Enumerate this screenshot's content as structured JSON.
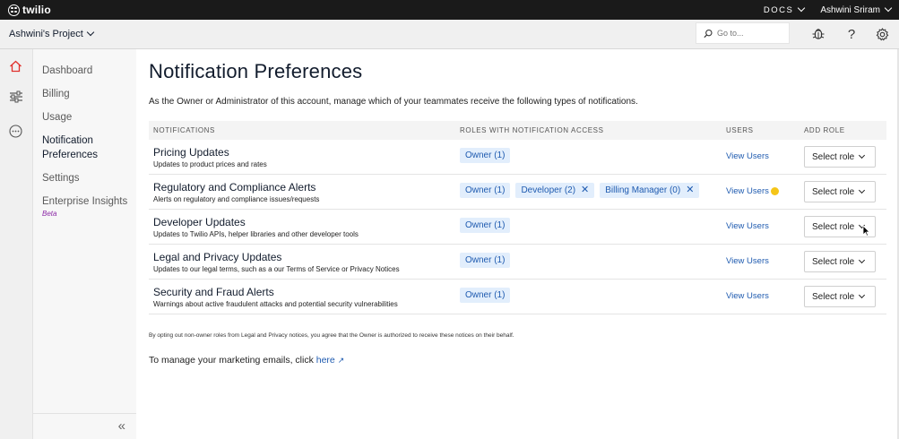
{
  "topbar": {
    "logo_text": "twilio",
    "docs_label": "DOCS",
    "user_name": "Ashwini Sriram"
  },
  "projectbar": {
    "project_name": "Ashwini's Project",
    "search_placeholder": "Go to..."
  },
  "sidebar": {
    "items": [
      {
        "label": "Dashboard"
      },
      {
        "label": "Billing"
      },
      {
        "label": "Usage"
      },
      {
        "label": "Notification Preferences"
      },
      {
        "label": "Settings"
      },
      {
        "label": "Enterprise Insights"
      }
    ],
    "beta_label": "Beta",
    "active_item": "Notification Preferences"
  },
  "main": {
    "title": "Notification Preferences",
    "intro": "As the Owner or Administrator of this account, manage which of your teammates receive the following types of notifications.",
    "columns": [
      "NOTIFICATIONS",
      "ROLES WITH NOTIFICATION ACCESS",
      "USERS",
      "ADD ROLE"
    ],
    "rows": [
      {
        "title": "Pricing Updates",
        "description": "Updates to product prices and rates",
        "roles": [
          {
            "label": "Owner (1)",
            "removable": false
          }
        ],
        "users_link": "View Users",
        "add_role": "Select role"
      },
      {
        "title": "Regulatory and Compliance Alerts",
        "description": "Alerts on regulatory and compliance issues/requests",
        "roles": [
          {
            "label": "Owner (1)",
            "removable": false
          },
          {
            "label": "Developer (2)",
            "removable": true
          },
          {
            "label": "Billing Manager (0)",
            "removable": true
          }
        ],
        "users_link": "View Users",
        "add_role": "Select role"
      },
      {
        "title": "Developer Updates",
        "description": "Updates to Twilio APIs, helper libraries and other developer tools",
        "roles": [
          {
            "label": "Owner (1)",
            "removable": false
          }
        ],
        "users_link": "View Users",
        "add_role": "Select role"
      },
      {
        "title": "Legal and Privacy Updates",
        "description": "Updates to our legal terms, such as a our Terms of Service or Privacy Notices",
        "roles": [
          {
            "label": "Owner (1)",
            "removable": false
          }
        ],
        "users_link": "View Users",
        "add_role": "Select role"
      },
      {
        "title": "Security and Fraud Alerts",
        "description": "Warnings about active fraudulent attacks and potential security vulnerabilities",
        "roles": [
          {
            "label": "Owner (1)",
            "removable": false
          }
        ],
        "users_link": "View Users",
        "add_role": "Select role"
      }
    ],
    "footnote": "By opting out non-owner roles from Legal and Privacy notices, you agree that the Owner is authorized to receive these notices on their behalf.",
    "marketing_text": "To manage your marketing emails, click",
    "marketing_link": "here"
  },
  "colors": {
    "topbar": "#1a1a1a",
    "accent": "#1f5bb0",
    "pill_bg": "#e2eefc",
    "warning": "#f5c518",
    "beta": "#8c2aa6",
    "home_icon": "#e0302c"
  },
  "icons": [
    "twilio-logo",
    "search-icon",
    "bug-icon",
    "help-icon",
    "gear-icon",
    "home-icon",
    "filter-icon",
    "more-icon",
    "close-icon",
    "external-link-icon",
    "warning-dot",
    "collapse-icon"
  ]
}
